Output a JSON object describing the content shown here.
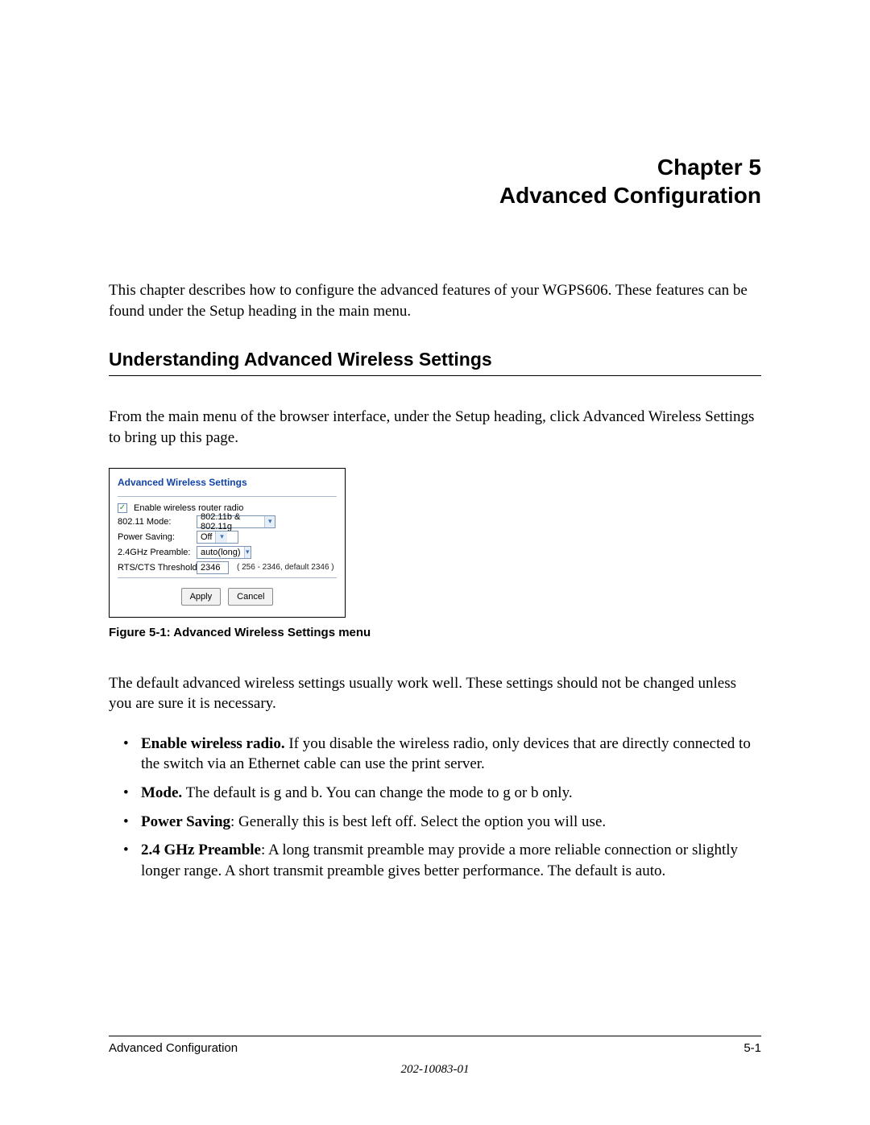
{
  "chapter": {
    "number_line": "Chapter 5",
    "title_line": "Advanced Configuration"
  },
  "intro": "This chapter describes how to configure the advanced features of your WGPS606. These features can be found under the Setup heading in the main menu.",
  "section_heading": "Understanding Advanced Wireless Settings",
  "para_before_fig": "From the main menu of the browser interface, under the Setup heading, click Advanced Wireless Settings to bring up this page.",
  "screenshot": {
    "title": "Advanced Wireless Settings",
    "enable_checked_glyph": "✓",
    "enable_label": "Enable wireless router radio",
    "rows": {
      "mode_label": "802.11 Mode:",
      "mode_value": "802.11b & 802.11g",
      "power_label": "Power Saving:",
      "power_value": "Off",
      "preamble_label": "2.4GHz Preamble:",
      "preamble_value": "auto(long)",
      "rts_label": "RTS/CTS Threshold:",
      "rts_value": "2346",
      "rts_hint": "( 256 - 2346, default 2346 )"
    },
    "buttons": {
      "apply": "Apply",
      "cancel": "Cancel"
    }
  },
  "figure_caption": "Figure 5-1:  Advanced Wireless Settings menu",
  "para_after_fig": "The default advanced wireless settings usually work well. These settings should not be changed unless you are sure it is necessary.",
  "bullets": {
    "b1_bold": "Enable wireless radio.",
    "b1_rest": " If you disable the wireless radio, only devices that are directly connected to the switch via an Ethernet cable can use the print server.",
    "b2_bold": "Mode.",
    "b2_rest": " The default is g and b. You can change the mode to g or b only.",
    "b3_bold": "Power Saving",
    "b3_rest": ": Generally this is best left off. Select the option you will use.",
    "b4_bold": "2.4 GHz Preamble",
    "b4_rest": ": A long transmit preamble may provide a more reliable connection or slightly longer range. A short transmit preamble gives better performance. The default is auto."
  },
  "footer": {
    "left": "Advanced Configuration",
    "right": "5-1",
    "doc_id": "202-10083-01"
  }
}
